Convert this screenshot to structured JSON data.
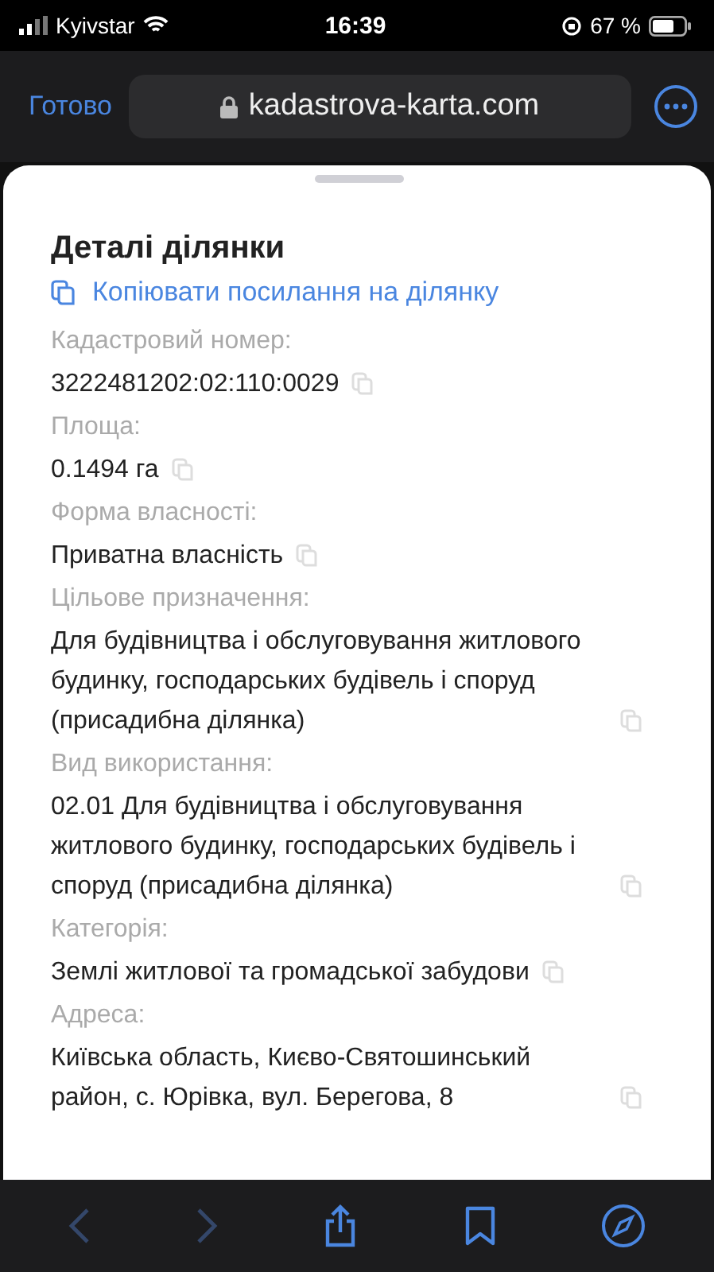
{
  "status_bar": {
    "carrier": "Kyivstar",
    "time": "16:39",
    "battery": "67 %"
  },
  "browser_bar": {
    "done": "Готово",
    "url": "kadastrova-karta.com"
  },
  "sheet": {
    "title": "Деталі ділянки",
    "copy_link": "Копіювати посилання на ділянку",
    "fields": [
      {
        "label": "Кадастровий номер:",
        "value": "3222481202:02:110:0029"
      },
      {
        "label": "Площа:",
        "value": "0.1494 га"
      },
      {
        "label": "Форма власності:",
        "value": "Приватна власність"
      },
      {
        "label": "Цільове призначення:",
        "value": "Для будівництва і обслуговування житлового будинку, господарських будівель і споруд (присадибна ділянка)"
      },
      {
        "label": "Вид використання:",
        "value": "02.01 Для будівництва і обслуговування житлового будинку, господарських будівель і споруд (присадибна ділянка)"
      },
      {
        "label": "Категорія:",
        "value": "Землі житлової та громадської забудови"
      },
      {
        "label": "Адреса:",
        "value": "Київська область, Києво-Святошинський район, с. Юрівка, вул. Берегова, 8"
      }
    ]
  },
  "toolbar": [
    {
      "kind": "back",
      "disabled": true
    },
    {
      "kind": "forward",
      "disabled": true
    },
    {
      "kind": "share",
      "disabled": false
    },
    {
      "kind": "bookmarks",
      "disabled": false
    },
    {
      "kind": "compass",
      "disabled": false
    }
  ]
}
